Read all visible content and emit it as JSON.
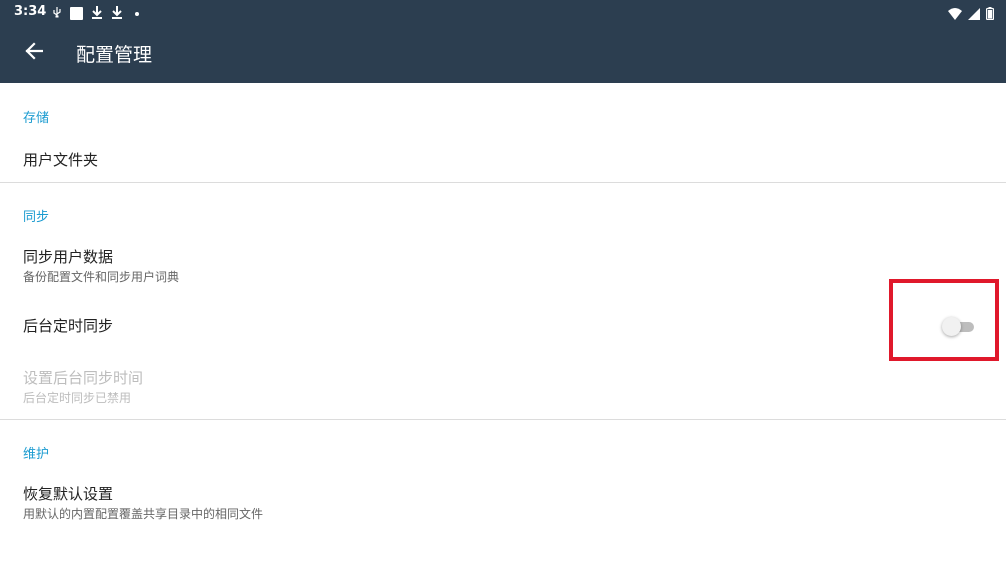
{
  "status_bar": {
    "time": "3:34",
    "left_icons": [
      "usb-icon",
      "notification-square-icon",
      "download-icon",
      "download-icon",
      "dot-icon"
    ],
    "right_icons": [
      "wifi-icon",
      "signal-icon",
      "battery-icon"
    ]
  },
  "app_bar": {
    "back_icon": "arrow-back-icon",
    "title": "配置管理"
  },
  "sections": {
    "storage": {
      "header": "存储",
      "user_folder": {
        "title": "用户文件夹"
      }
    },
    "sync": {
      "header": "同步",
      "sync_user_data": {
        "title": "同步用户数据",
        "summary": "备份配置文件和同步用户词典"
      },
      "background_sync": {
        "title": "后台定时同步",
        "enabled": false
      },
      "set_sync_time": {
        "title": "设置后台同步时间",
        "summary": "后台定时同步已禁用"
      }
    },
    "maintenance": {
      "header": "维护",
      "reset_defaults": {
        "title": "恢复默认设置",
        "summary": "用默认的内置配置覆盖共享目录中的相同文件"
      }
    }
  },
  "colors": {
    "app_bar": "#2c3e50",
    "category_accent": "#1a9bd0",
    "highlight": "#e0182b"
  }
}
